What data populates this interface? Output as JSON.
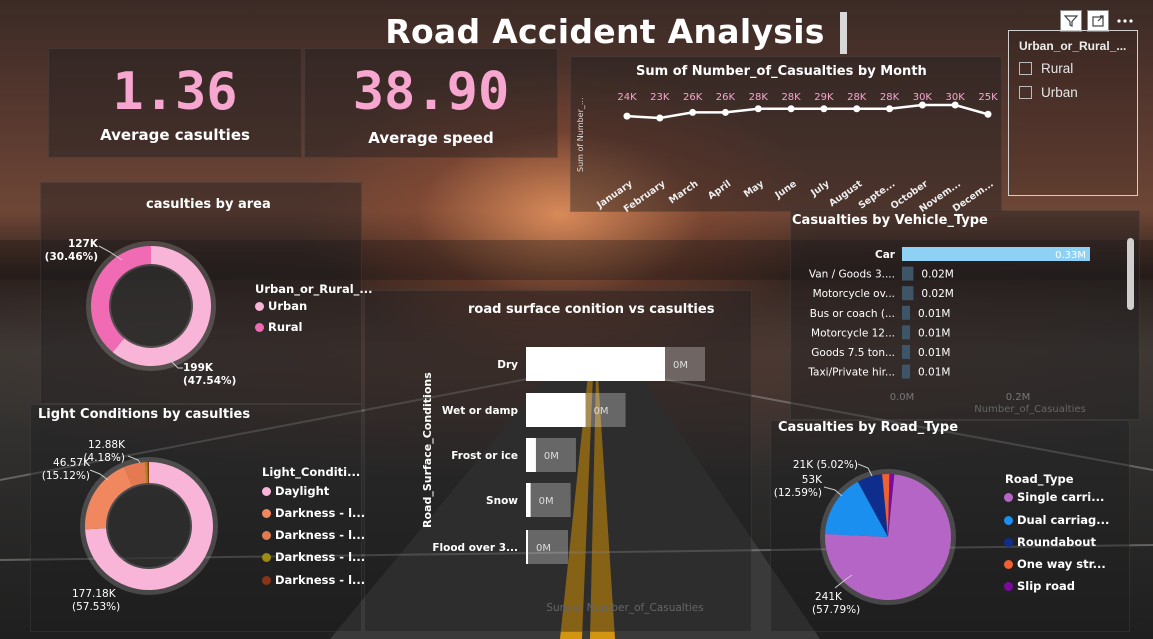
{
  "dashboard": {
    "title": "Road Accident Analysis"
  },
  "kpis": {
    "avg_casualties": {
      "value": "1.36",
      "label": "Average casulties"
    },
    "avg_speed": {
      "value": "38.90",
      "label": "Average speed"
    }
  },
  "slicer": {
    "title": "Urban_or_Rural_...",
    "options": [
      "Rural",
      "Urban"
    ]
  },
  "colors": {
    "kpi_pink": "#f7a6cf",
    "urban": "#f9b5d8",
    "rural": "#f06ab4",
    "daylight": "#f9b5d8",
    "darkness1": "#f0875f",
    "darkness2": "#e57a52",
    "darkness3": "#a08a16",
    "darkness4": "#8b3418",
    "car_bar": "#8fd0f5",
    "vehicle_bar": "#3d5566",
    "single": "#b565c6",
    "dual": "#1a8ff0",
    "roundabout": "#0e2d8c",
    "oneway": "#f06030",
    "sliproad": "#7c0a9e"
  },
  "chart_data": [
    {
      "type": "line",
      "title": "Sum of Number_of_Casualties by Month",
      "ylabel": "Sum of Number_...",
      "categories": [
        "January",
        "February",
        "March",
        "April",
        "May",
        "June",
        "July",
        "August",
        "Septe...",
        "October",
        "Novem...",
        "Decem..."
      ],
      "values": [
        24000,
        23000,
        26000,
        26000,
        28000,
        28000,
        28000,
        28000,
        28000,
        30000,
        30000,
        25000
      ],
      "data_labels": [
        "24K",
        "23K",
        "26K",
        "26K",
        "28K",
        "28K",
        "29K",
        "28K",
        "28K",
        "30K",
        "30K",
        "25K"
      ]
    },
    {
      "type": "pie",
      "title": "casulties by area",
      "legend_title": "Urban_or_Rural_...",
      "categories": [
        "Urban",
        "Rural"
      ],
      "values": [
        199000,
        127000
      ],
      "data_labels": [
        [
          "199K",
          "(47.54%)"
        ],
        [
          "127K",
          "(30.46%)"
        ]
      ]
    },
    {
      "type": "pie",
      "title": "Light Conditions by casulties",
      "legend_title": "Light_Conditi...",
      "categories": [
        "Daylight",
        "Darkness - l...",
        "Darkness - l...",
        "Darkness - l...",
        "Darkness - l..."
      ],
      "values": [
        177180,
        46570,
        12880,
        1500,
        800
      ],
      "data_labels": [
        [
          "177.18K",
          "(57.53%)"
        ],
        [
          "46.57K",
          "(15.12%)"
        ],
        [
          "12.88K",
          "(4.18%)"
        ]
      ]
    },
    {
      "type": "bar",
      "title": "road surface conition vs casulties",
      "ylabel": "Road_Surface_Conditions",
      "xlabel": "Sum of Number_of_Casualties",
      "categories": [
        "Dry",
        "Wet or damp",
        "Frost or ice",
        "Snow",
        "Flood over 3..."
      ],
      "values": [
        0.21,
        0.09,
        0.015,
        0.007,
        0.001
      ],
      "data_labels": [
        "0M",
        "0M",
        "0M",
        "0M",
        "0M"
      ]
    },
    {
      "type": "bar",
      "title": "Casualties by Vehicle_Type",
      "xlabel": "Number_of_Casualties",
      "categories": [
        "Car",
        "Van / Goods 3....",
        "Motorcycle ov...",
        "Bus or coach (...",
        "Motorcycle 12...",
        "Goods 7.5 ton...",
        "Taxi/Private hir..."
      ],
      "values": [
        0.33,
        0.02,
        0.02,
        0.01,
        0.01,
        0.01,
        0.01
      ],
      "data_labels": [
        "0.33M",
        "0.02M",
        "0.02M",
        "0.01M",
        "0.01M",
        "0.01M",
        "0.01M"
      ],
      "x_ticks": [
        "0.0M",
        "0.2M"
      ]
    },
    {
      "type": "pie",
      "title": "Casualties by Road_Type",
      "legend_title": "Road_Type",
      "categories": [
        "Single carri...",
        "Dual carriag...",
        "Roundabout",
        "One way str...",
        "Slip road"
      ],
      "values": [
        241000,
        53000,
        21000,
        6000,
        4000
      ],
      "data_labels": [
        [
          "241K",
          "(57.79%)"
        ],
        [
          "53K",
          "(12.59%)"
        ],
        [
          "21K (5.02%)"
        ]
      ]
    }
  ]
}
